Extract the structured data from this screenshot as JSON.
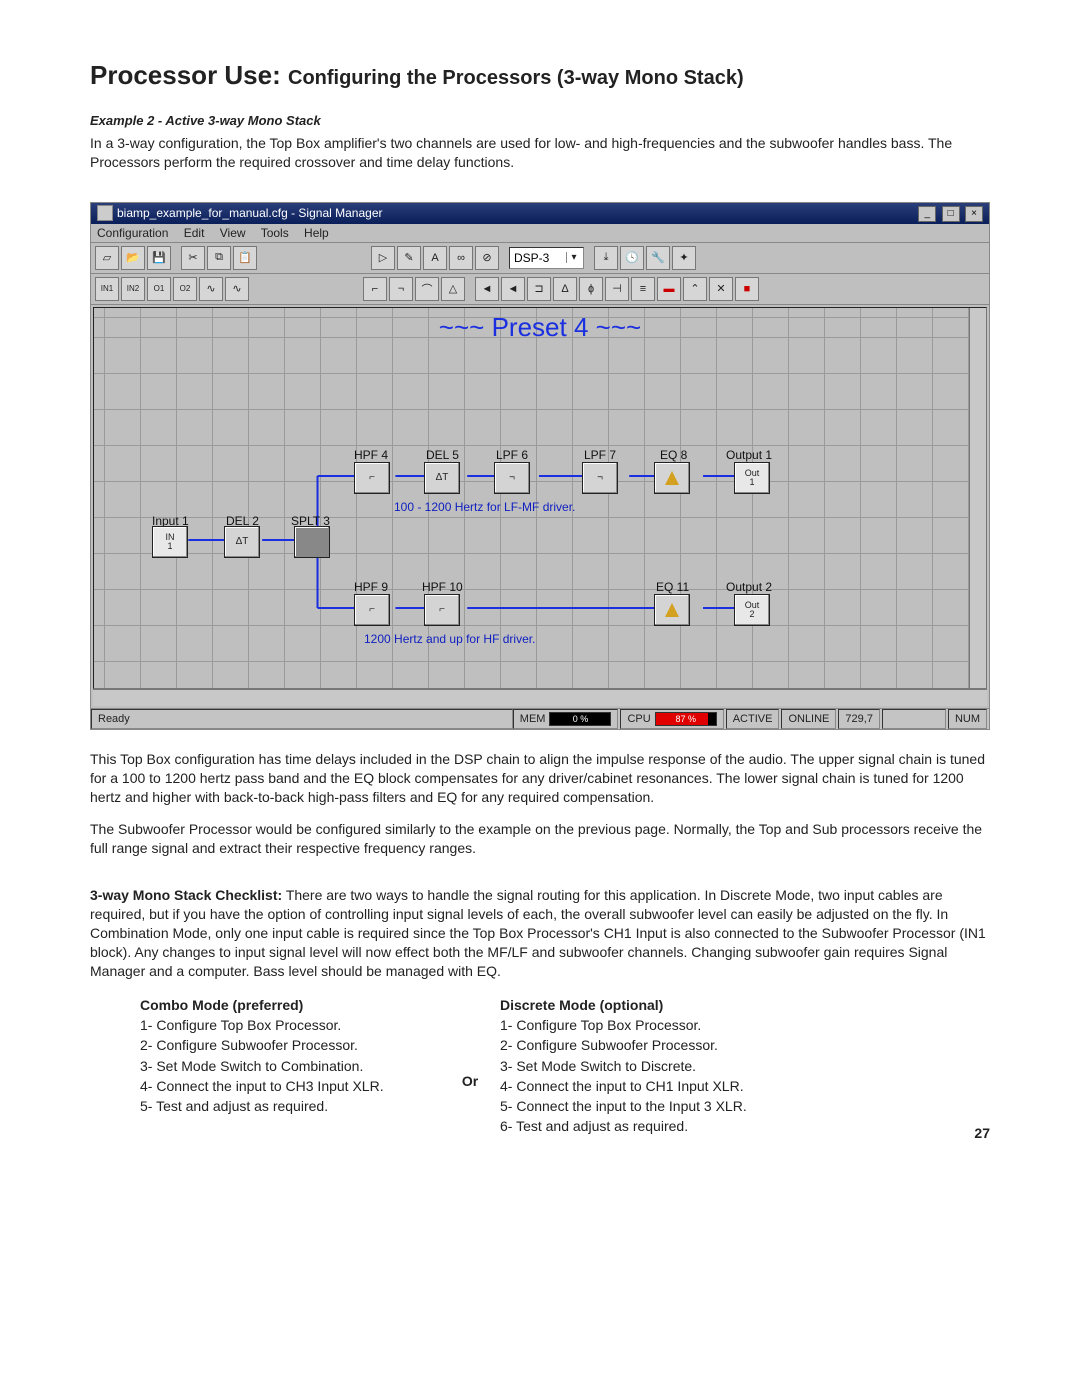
{
  "header": {
    "title_strong": "Processor Use:",
    "title_rest": "Configuring the Processors (3-way Mono Stack)"
  },
  "example_label": "Example 2 - Active 3-way Mono Stack",
  "intro_para": "In a 3-way configuration, the Top Box amplifier's two channels are used for low- and high-frequencies and the subwoofer handles bass. The Processors perform the required crossover and time delay functions.",
  "app": {
    "title": "biamp_example_for_manual.cfg - Signal Manager",
    "menus": [
      "Configuration",
      "Edit",
      "View",
      "Tools",
      "Help"
    ],
    "dsp_field": "DSP-3",
    "preset_title": "~~~ Preset 4 ~~~",
    "nodes": {
      "input1": "Input 1",
      "in1": "IN\n1",
      "del2": "DEL 2",
      "splt3": "SPLT 3",
      "hpf4": "HPF 4",
      "del5": "DEL 5",
      "lpf6": "LPF 6",
      "lpf7": "LPF 7",
      "eq8": "EQ 8",
      "out1lbl": "Output 1",
      "hpf9": "HPF 9",
      "hpf10": "HPF 10",
      "eq11": "EQ 11",
      "out2lbl": "Output 2",
      "out1": "Out\n1",
      "out2": "Out\n2"
    },
    "note_upper": "100 - 1200 Hertz for LF-MF driver.",
    "note_lower": "1200 Hertz and up for HF driver.",
    "status": {
      "ready": "Ready",
      "mem": "MEM",
      "mem_pct": "0 %",
      "cpu": "CPU",
      "cpu_pct": "87 %",
      "active": "ACTIVE",
      "online": "ONLINE",
      "coord": "729,7",
      "num": "NUM"
    }
  },
  "after_para1": "This Top Box configuration has time delays included in the DSP chain to align the impulse response of the audio. The upper signal chain is tuned for a 100 to 1200 hertz pass band and the EQ block compensates for any driver/cabinet resonances. The lower signal chain is tuned for 1200 hertz and higher with back-to-back high-pass filters and EQ for any required compensation.",
  "after_para2": "The Subwoofer Processor would be configured similarly to the example on the previous page. Normally, the Top and Sub processors receive the full range signal and extract their respective frequency ranges.",
  "checklist_lead_strong": "3-way Mono Stack Checklist:",
  "checklist_lead": "There are two ways to handle the signal routing for this application. In Discrete Mode, two input cables are required, but if you have the option of controlling input signal levels of each, the overall subwoofer level can easily be adjusted on the fly. In Combination Mode, only one input cable is required since the Top Box Processor's CH1 Input is also connected to the Subwoofer Processor (IN1 block). Any changes to input signal level will now effect both the MF/LF and subwoofer channels. Changing subwoofer gain requires Signal Manager and a computer. Bass level should be managed with EQ.",
  "combo": {
    "title": "Combo Mode (preferred)",
    "steps": [
      "1- Configure Top Box Processor.",
      "2- Configure Subwoofer Processor.",
      "3- Set Mode Switch to Combination.",
      "4- Connect the input to CH3 Input XLR.",
      "5- Test and adjust as required."
    ]
  },
  "or_label": "Or",
  "discrete": {
    "title": "Discrete Mode (optional)",
    "steps": [
      "1- Configure Top Box Processor.",
      "2- Configure Subwoofer Processor.",
      "3- Set Mode Switch to Discrete.",
      "4- Connect the input to CH1 Input XLR.",
      "5- Connect the input to the Input 3 XLR.",
      "6- Test and adjust as required."
    ]
  },
  "page_number": "27"
}
